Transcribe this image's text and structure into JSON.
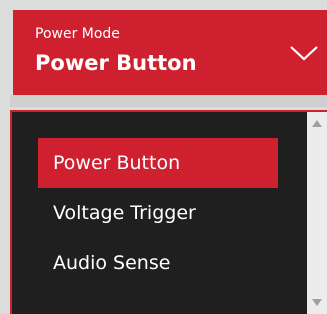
{
  "power_mode": {
    "label": "Power Mode",
    "selected_value": "Power Button",
    "dropdown_icon": "chevron-down-icon"
  },
  "dropdown": {
    "options": [
      {
        "label": "Power Button",
        "selected": true
      },
      {
        "label": "Voltage Trigger",
        "selected": false
      },
      {
        "label": "Audio Sense",
        "selected": false
      }
    ],
    "scroll_up_icon": "scroll-up-arrow-icon",
    "scroll_down_icon": "scroll-down-arrow-icon"
  },
  "colors": {
    "accent": "#cf2030",
    "panel_bg": "#1f1f1f",
    "text": "#ffffff",
    "scrollbar": "#ececec"
  }
}
